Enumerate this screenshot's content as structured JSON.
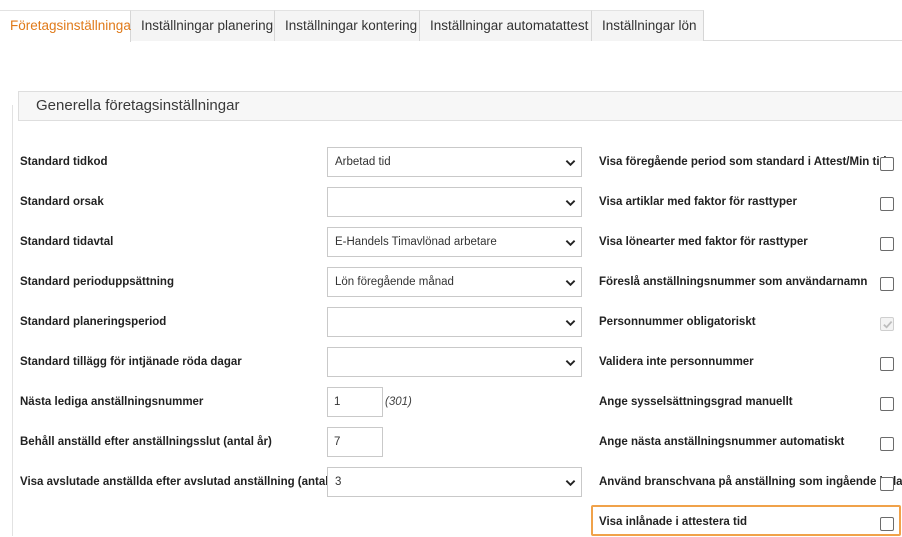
{
  "tabs": [
    {
      "label": "Företagsinställningar",
      "active": true
    },
    {
      "label": "Inställningar planering",
      "active": false
    },
    {
      "label": "Inställningar kontering",
      "active": false
    },
    {
      "label": "Inställningar automatattest",
      "active": false
    },
    {
      "label": "Inställningar lön",
      "active": false
    }
  ],
  "section": {
    "title": "Generella företagsinställningar"
  },
  "left_settings": [
    {
      "label": "Standard tidkod",
      "type": "select",
      "value": "Arbetad tid"
    },
    {
      "label": "Standard orsak",
      "type": "select",
      "value": ""
    },
    {
      "label": "Standard tidavtal",
      "type": "select",
      "value": "E-Handels Timavlönad arbetare"
    },
    {
      "label": "Standard perioduppsättning",
      "type": "select",
      "value": "Lön föregående månad"
    },
    {
      "label": "Standard planeringsperiod",
      "type": "select",
      "value": ""
    },
    {
      "label": "Standard tillägg för intjänade röda dagar",
      "type": "select",
      "value": ""
    },
    {
      "label": "Nästa lediga anställningsnummer",
      "type": "input",
      "value": "1",
      "hint": "(301)"
    },
    {
      "label": "Behåll anställd efter anställningsslut (antal år)",
      "type": "input",
      "value": "7"
    },
    {
      "label": "Visa avslutade anställda efter avslutad anställning (antal mån)",
      "type": "select",
      "value": "3"
    }
  ],
  "right_settings": [
    {
      "label": "Visa föregående period som standard i Attest/Min tid",
      "checked": false,
      "disabled": false
    },
    {
      "label": "Visa artiklar med faktor för rasttyper",
      "checked": false,
      "disabled": false
    },
    {
      "label": "Visa lönearter med faktor för rasttyper",
      "checked": false,
      "disabled": false
    },
    {
      "label": "Föreslå anställningsnummer som användarnamn",
      "checked": false,
      "disabled": false
    },
    {
      "label": "Personnummer obligatoriskt",
      "checked": true,
      "disabled": true
    },
    {
      "label": "Validera inte personnummer",
      "checked": false,
      "disabled": false
    },
    {
      "label": "Ange sysselsättningsgrad manuellt",
      "checked": false,
      "disabled": false
    },
    {
      "label": "Ange nästa anställningsnummer automatiskt",
      "checked": false,
      "disabled": false
    },
    {
      "label": "Använd branschvana på anställning som ingående balans",
      "checked": false,
      "disabled": false
    },
    {
      "label": "Visa inlånade i attestera tid",
      "checked": false,
      "disabled": false,
      "highlighted": true
    }
  ],
  "colors": {
    "accent": "#e07a1a",
    "highlight": "#f0a24a"
  },
  "icons": {
    "select": "chevron-down-icon",
    "checked": "check-icon"
  }
}
